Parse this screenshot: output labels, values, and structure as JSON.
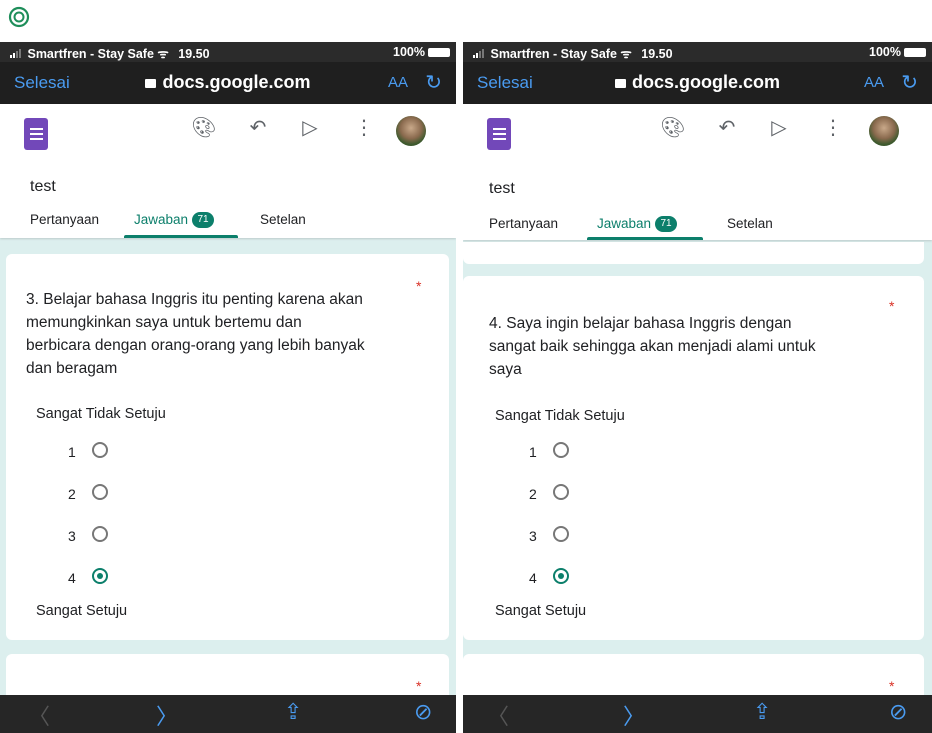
{
  "top_icon": "circle-logo-icon",
  "colors": {
    "accent": "#0c7f6b",
    "forms_purple": "#7248b9",
    "ios_blue": "#4a9bf0",
    "required": "#d93025"
  },
  "phones": [
    {
      "status": {
        "carrier": "Smartfren - Stay Safe",
        "time": "19.50",
        "battery": "100%"
      },
      "browser": {
        "done": "Selesai",
        "url": "docs.google.com",
        "text_size": "AA"
      },
      "form": {
        "title": "test",
        "tabs": {
          "questions": "Pertanyaan",
          "responses": "Jawaban",
          "responses_count": "71",
          "settings": "Setelan"
        }
      },
      "question": {
        "lines": [
          "3. Belajar bahasa Inggris itu penting karena akan",
          "memungkinkan saya untuk bertemu dan",
          "berbicara dengan orang-orang yang lebih banyak",
          "dan beragam"
        ],
        "required_mark": "*",
        "low_label": "Sangat Tidak Setuju",
        "high_label": "Sangat Setuju",
        "options": [
          "1",
          "2",
          "3",
          "4"
        ],
        "selected": "4"
      },
      "next_required_mark": "*"
    },
    {
      "status": {
        "carrier": "Smartfren - Stay Safe",
        "time": "19.50",
        "battery": "100%"
      },
      "browser": {
        "done": "Selesai",
        "url": "docs.google.com",
        "text_size": "AA"
      },
      "form": {
        "title": "test",
        "tabs": {
          "questions": "Pertanyaan",
          "responses": "Jawaban",
          "responses_count": "71",
          "settings": "Setelan"
        }
      },
      "question": {
        "lines": [
          "4. Saya ingin belajar bahasa Inggris dengan",
          "sangat baik sehingga akan menjadi alami untuk",
          "saya"
        ],
        "required_mark": "*",
        "low_label": "Sangat Tidak Setuju",
        "high_label": "Sangat Setuju",
        "options": [
          "1",
          "2",
          "3",
          "4"
        ],
        "selected": "4"
      },
      "next_required_mark": "*"
    }
  ]
}
